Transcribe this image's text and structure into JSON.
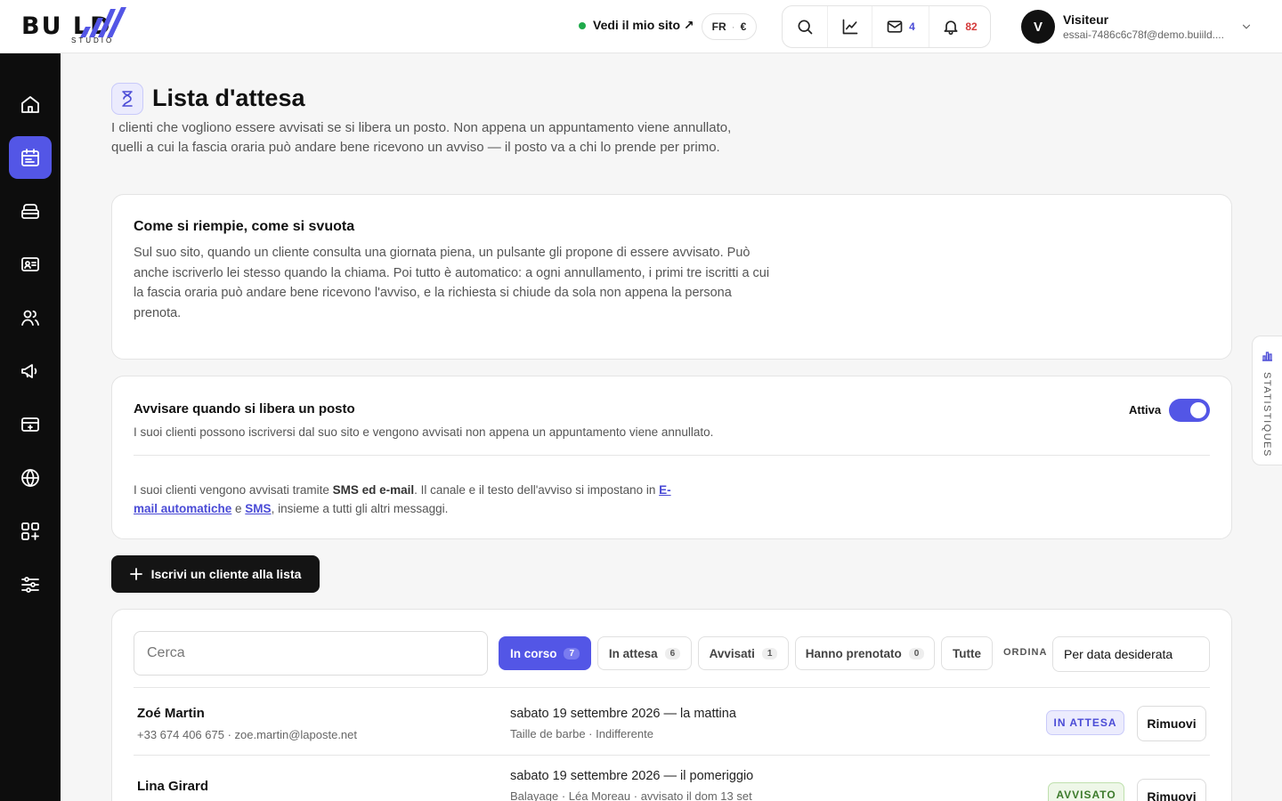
{
  "brand": {
    "logo_main": "BU   LD",
    "logo_sub": "STUDIO",
    "accent": "#5356e6"
  },
  "header": {
    "site_link": "Vedi il mio sito ↗",
    "lang": "FR",
    "currency": "€",
    "messages_count": "4",
    "notifications_count": "82",
    "user": {
      "initial": "V",
      "name": "Visiteur",
      "email": "essai-7486c6c78f@demo.buiild...."
    }
  },
  "sidebar": {
    "items": [
      {
        "icon": "home-icon"
      },
      {
        "icon": "calendar-icon",
        "active": true
      },
      {
        "icon": "services-icon"
      },
      {
        "icon": "contact-card-icon"
      },
      {
        "icon": "clients-icon"
      },
      {
        "icon": "megaphone-icon"
      },
      {
        "icon": "payment-icon"
      },
      {
        "icon": "globe-icon"
      },
      {
        "icon": "apps-icon"
      },
      {
        "icon": "settings-sliders-icon"
      }
    ]
  },
  "page": {
    "title": "Lista d'attesa",
    "description": "I clienti che vogliono essere avvisati se si libera un posto. Non appena un appuntamento viene annullato, quelli a cui la fascia oraria può andare bene ricevono un avviso — il posto va a chi lo prende per primo."
  },
  "info_card": {
    "title": "Come si riempie, come si svuota",
    "text": "Sul suo sito, quando un cliente consulta una giornata piena, un pulsante gli propone di essere avvisato. Può anche iscriverlo lei stesso quando la chiama. Poi tutto è automatico: a ogni annullamento, i primi tre iscritti a cui la fascia oraria può andare bene ricevono l'avviso, e la richiesta si chiude da sola non appena la persona prenota."
  },
  "notify_card": {
    "title": "Avvisare quando si libera un posto",
    "subtitle": "I suoi clienti possono iscriversi dal suo sito e vengono avvisati non appena un appuntamento viene annullato.",
    "toggle_label": "Attiva",
    "toggle_on": true,
    "note_pre": "I suoi clienti vengono avvisati tramite ",
    "note_channels": "SMS ed e-mail",
    "note_mid": ". Il canale e il testo dell'avviso si impostano in ",
    "note_link1": "E-mail automatiche",
    "note_and": " e ",
    "note_link2": "SMS",
    "note_post": ", insieme a tutti gli altri messaggi."
  },
  "add_button": "Iscrivi un cliente alla lista",
  "list": {
    "search_placeholder": "Cerca",
    "filters": [
      {
        "label": "In corso",
        "count": "7",
        "active": true
      },
      {
        "label": "In attesa",
        "count": "6"
      },
      {
        "label": "Avvisati",
        "count": "1"
      },
      {
        "label": "Hanno prenotato",
        "count": "0"
      },
      {
        "label": "Tutte"
      }
    ],
    "sort_label": "ORDINA",
    "sort_value": "Per data desiderata",
    "rows": [
      {
        "name": "Zoé Martin",
        "contact": "+33 674 406 675 · zoe.martin@laposte.net",
        "date": "sabato 19 settembre 2026 — la mattina",
        "meta": "Taille de barbe · Indifferente",
        "status": "IN ATTESA",
        "action": "Rimuovi"
      },
      {
        "name": "Lina Girard",
        "contact": "",
        "date": "sabato 19 settembre 2026 — il pomeriggio",
        "meta": "Balayage · Léa Moreau · avvisato il dom 13 set",
        "status": "AVVISATO",
        "action": "Rimuovi"
      }
    ]
  },
  "stats_tab": "STATISTIQUES"
}
